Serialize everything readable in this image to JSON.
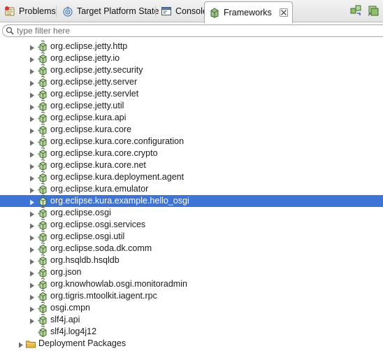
{
  "tabs": [
    {
      "id": "problems",
      "label": "Problems",
      "icon": "problems-icon",
      "active": false
    },
    {
      "id": "target-platform-state",
      "label": "Target Platform State",
      "icon": "target-platform-icon",
      "active": false
    },
    {
      "id": "console",
      "label": "Console",
      "icon": "console-icon",
      "active": false
    },
    {
      "id": "frameworks",
      "label": "Frameworks",
      "icon": "frameworks-icon",
      "active": true
    }
  ],
  "filter": {
    "placeholder": "type filter here",
    "value": ""
  },
  "tree": {
    "bundles": [
      {
        "label": "org.eclipse.jetty.http",
        "expandable": true,
        "selected": false
      },
      {
        "label": "org.eclipse.jetty.io",
        "expandable": true,
        "selected": false
      },
      {
        "label": "org.eclipse.jetty.security",
        "expandable": true,
        "selected": false
      },
      {
        "label": "org.eclipse.jetty.server",
        "expandable": true,
        "selected": false
      },
      {
        "label": "org.eclipse.jetty.servlet",
        "expandable": true,
        "selected": false
      },
      {
        "label": "org.eclipse.jetty.util",
        "expandable": true,
        "selected": false
      },
      {
        "label": "org.eclipse.kura.api",
        "expandable": true,
        "selected": false
      },
      {
        "label": "org.eclipse.kura.core",
        "expandable": true,
        "selected": false
      },
      {
        "label": "org.eclipse.kura.core.configuration",
        "expandable": true,
        "selected": false
      },
      {
        "label": "org.eclipse.kura.core.crypto",
        "expandable": true,
        "selected": false
      },
      {
        "label": "org.eclipse.kura.core.net",
        "expandable": true,
        "selected": false
      },
      {
        "label": "org.eclipse.kura.deployment.agent",
        "expandable": true,
        "selected": false
      },
      {
        "label": "org.eclipse.kura.emulator",
        "expandable": true,
        "selected": false
      },
      {
        "label": "org.eclipse.kura.example.hello_osgi",
        "expandable": true,
        "selected": true
      },
      {
        "label": "org.eclipse.osgi",
        "expandable": true,
        "selected": false
      },
      {
        "label": "org.eclipse.osgi.services",
        "expandable": true,
        "selected": false
      },
      {
        "label": "org.eclipse.osgi.util",
        "expandable": true,
        "selected": false
      },
      {
        "label": "org.eclipse.soda.dk.comm",
        "expandable": true,
        "selected": false
      },
      {
        "label": "org.hsqldb.hsqldb",
        "expandable": true,
        "selected": false
      },
      {
        "label": "org.json",
        "expandable": true,
        "selected": false
      },
      {
        "label": "org.knowhowlab.osgi.monitoradmin",
        "expandable": true,
        "selected": false
      },
      {
        "label": "org.tigris.mtoolkit.iagent.rpc",
        "expandable": true,
        "selected": false
      },
      {
        "label": "osgi.cmpn",
        "expandable": true,
        "selected": false
      },
      {
        "label": "slf4j.api",
        "expandable": true,
        "selected": false
      },
      {
        "label": "slf4j.log4j12",
        "expandable": false,
        "selected": false
      }
    ],
    "deployment_packages": {
      "label": "Deployment Packages",
      "icon": "folder-icon",
      "expandable": true
    }
  },
  "colors": {
    "selection": "#3d74d6",
    "bundle_icon": "#4a7a3d",
    "folder": "#e9b949"
  }
}
